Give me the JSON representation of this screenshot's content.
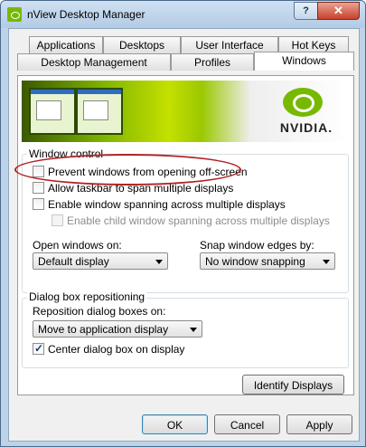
{
  "window": {
    "title": "nView Desktop Manager",
    "help_btn": "?",
    "close_btn": "✕"
  },
  "tabs_row1": [
    "Applications",
    "Desktops",
    "User Interface",
    "Hot Keys"
  ],
  "tabs_row2": [
    "Desktop Management",
    "Profiles",
    "Windows"
  ],
  "banner": {
    "logo_text": "NVIDIA."
  },
  "window_control": {
    "legend": "Window control",
    "prevent_offscreen": "Prevent windows from opening off-screen",
    "allow_taskbar": "Allow taskbar to span multiple displays",
    "enable_spanning": "Enable window spanning across multiple displays",
    "enable_child_spanning": "Enable child window spanning across multiple displays",
    "open_windows_label": "Open windows on:",
    "open_windows_value": "Default display",
    "snap_label": "Snap window edges by:",
    "snap_value": "No window snapping"
  },
  "dialog_box": {
    "legend": "Dialog box repositioning",
    "reposition_label": "Reposition dialog boxes on:",
    "reposition_value": "Move to application display",
    "center_label": "Center dialog box on display"
  },
  "buttons": {
    "identify": "Identify Displays",
    "ok": "OK",
    "cancel": "Cancel",
    "apply": "Apply"
  },
  "colors": {
    "nvidia_green": "#76b900",
    "highlight": "#b22323"
  }
}
